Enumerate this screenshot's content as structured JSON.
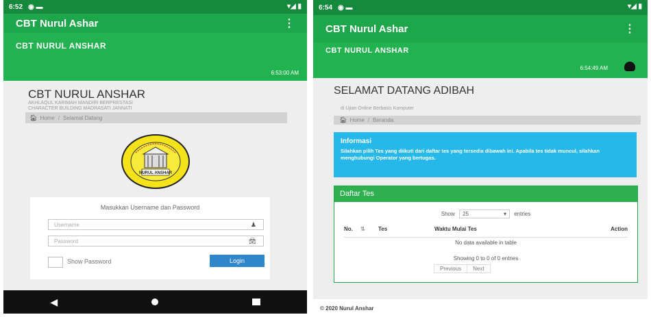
{
  "left": {
    "status_time": "6:52",
    "status_icons": "▾◢ ▮",
    "app_title": "CBT Nurul Ashar",
    "menu_glyph": "⋮",
    "brand": "CBT NURUL ANSHAR",
    "time": "6:53:00 AM",
    "page_title": "CBT NURUL ANSHAR",
    "subtitle_line1": "AKHLAQUL KARIMAH MANDIRI BERPRESTASI",
    "subtitle_line2": "CHARACTER BUILDING MADRASATI JANNATI",
    "breadcrumb_home": "Home",
    "breadcrumb_current": "Selamat Datang",
    "logo_text": "NURUL ANSHAR",
    "login_prompt": "Masukkan Username dan Password",
    "username_placeholder": "Username",
    "password_placeholder": "Password",
    "show_password": "Show Password",
    "login_button": "Login"
  },
  "right": {
    "status_time": "6:54",
    "status_icons": "▾◢ ▮",
    "app_title": "CBT Nurul Ashar",
    "menu_glyph": "⋮",
    "brand": "CBT NURUL ANSHAR",
    "time": "6:54:49 AM",
    "welcome": "SELAMAT DATANG ADIBAH",
    "subtitle": "di Ujian Online Berbasis Komputer",
    "breadcrumb_home": "Home",
    "breadcrumb_current": "Beranda",
    "info_title": "Informasi",
    "info_text": "Silahkan pilih Tes yang diikuti dari daftar tes yang tersedia dibawah ini. Apabila tes tidak muncul, silahkan menghubungi Operator yang bertugas.",
    "tests_title": "Daftar Tes",
    "show_label": "Show",
    "show_value": "25",
    "entries_label": "entries",
    "columns": [
      "No.",
      "Tes",
      "Waktu Mulai Tes",
      "Action"
    ],
    "empty": "No data available in table",
    "showing": "Showing 0 to 0 of 0 entries",
    "prev": "Previous",
    "next": "Next",
    "footer": "© 2020 Nurul Anshar"
  }
}
